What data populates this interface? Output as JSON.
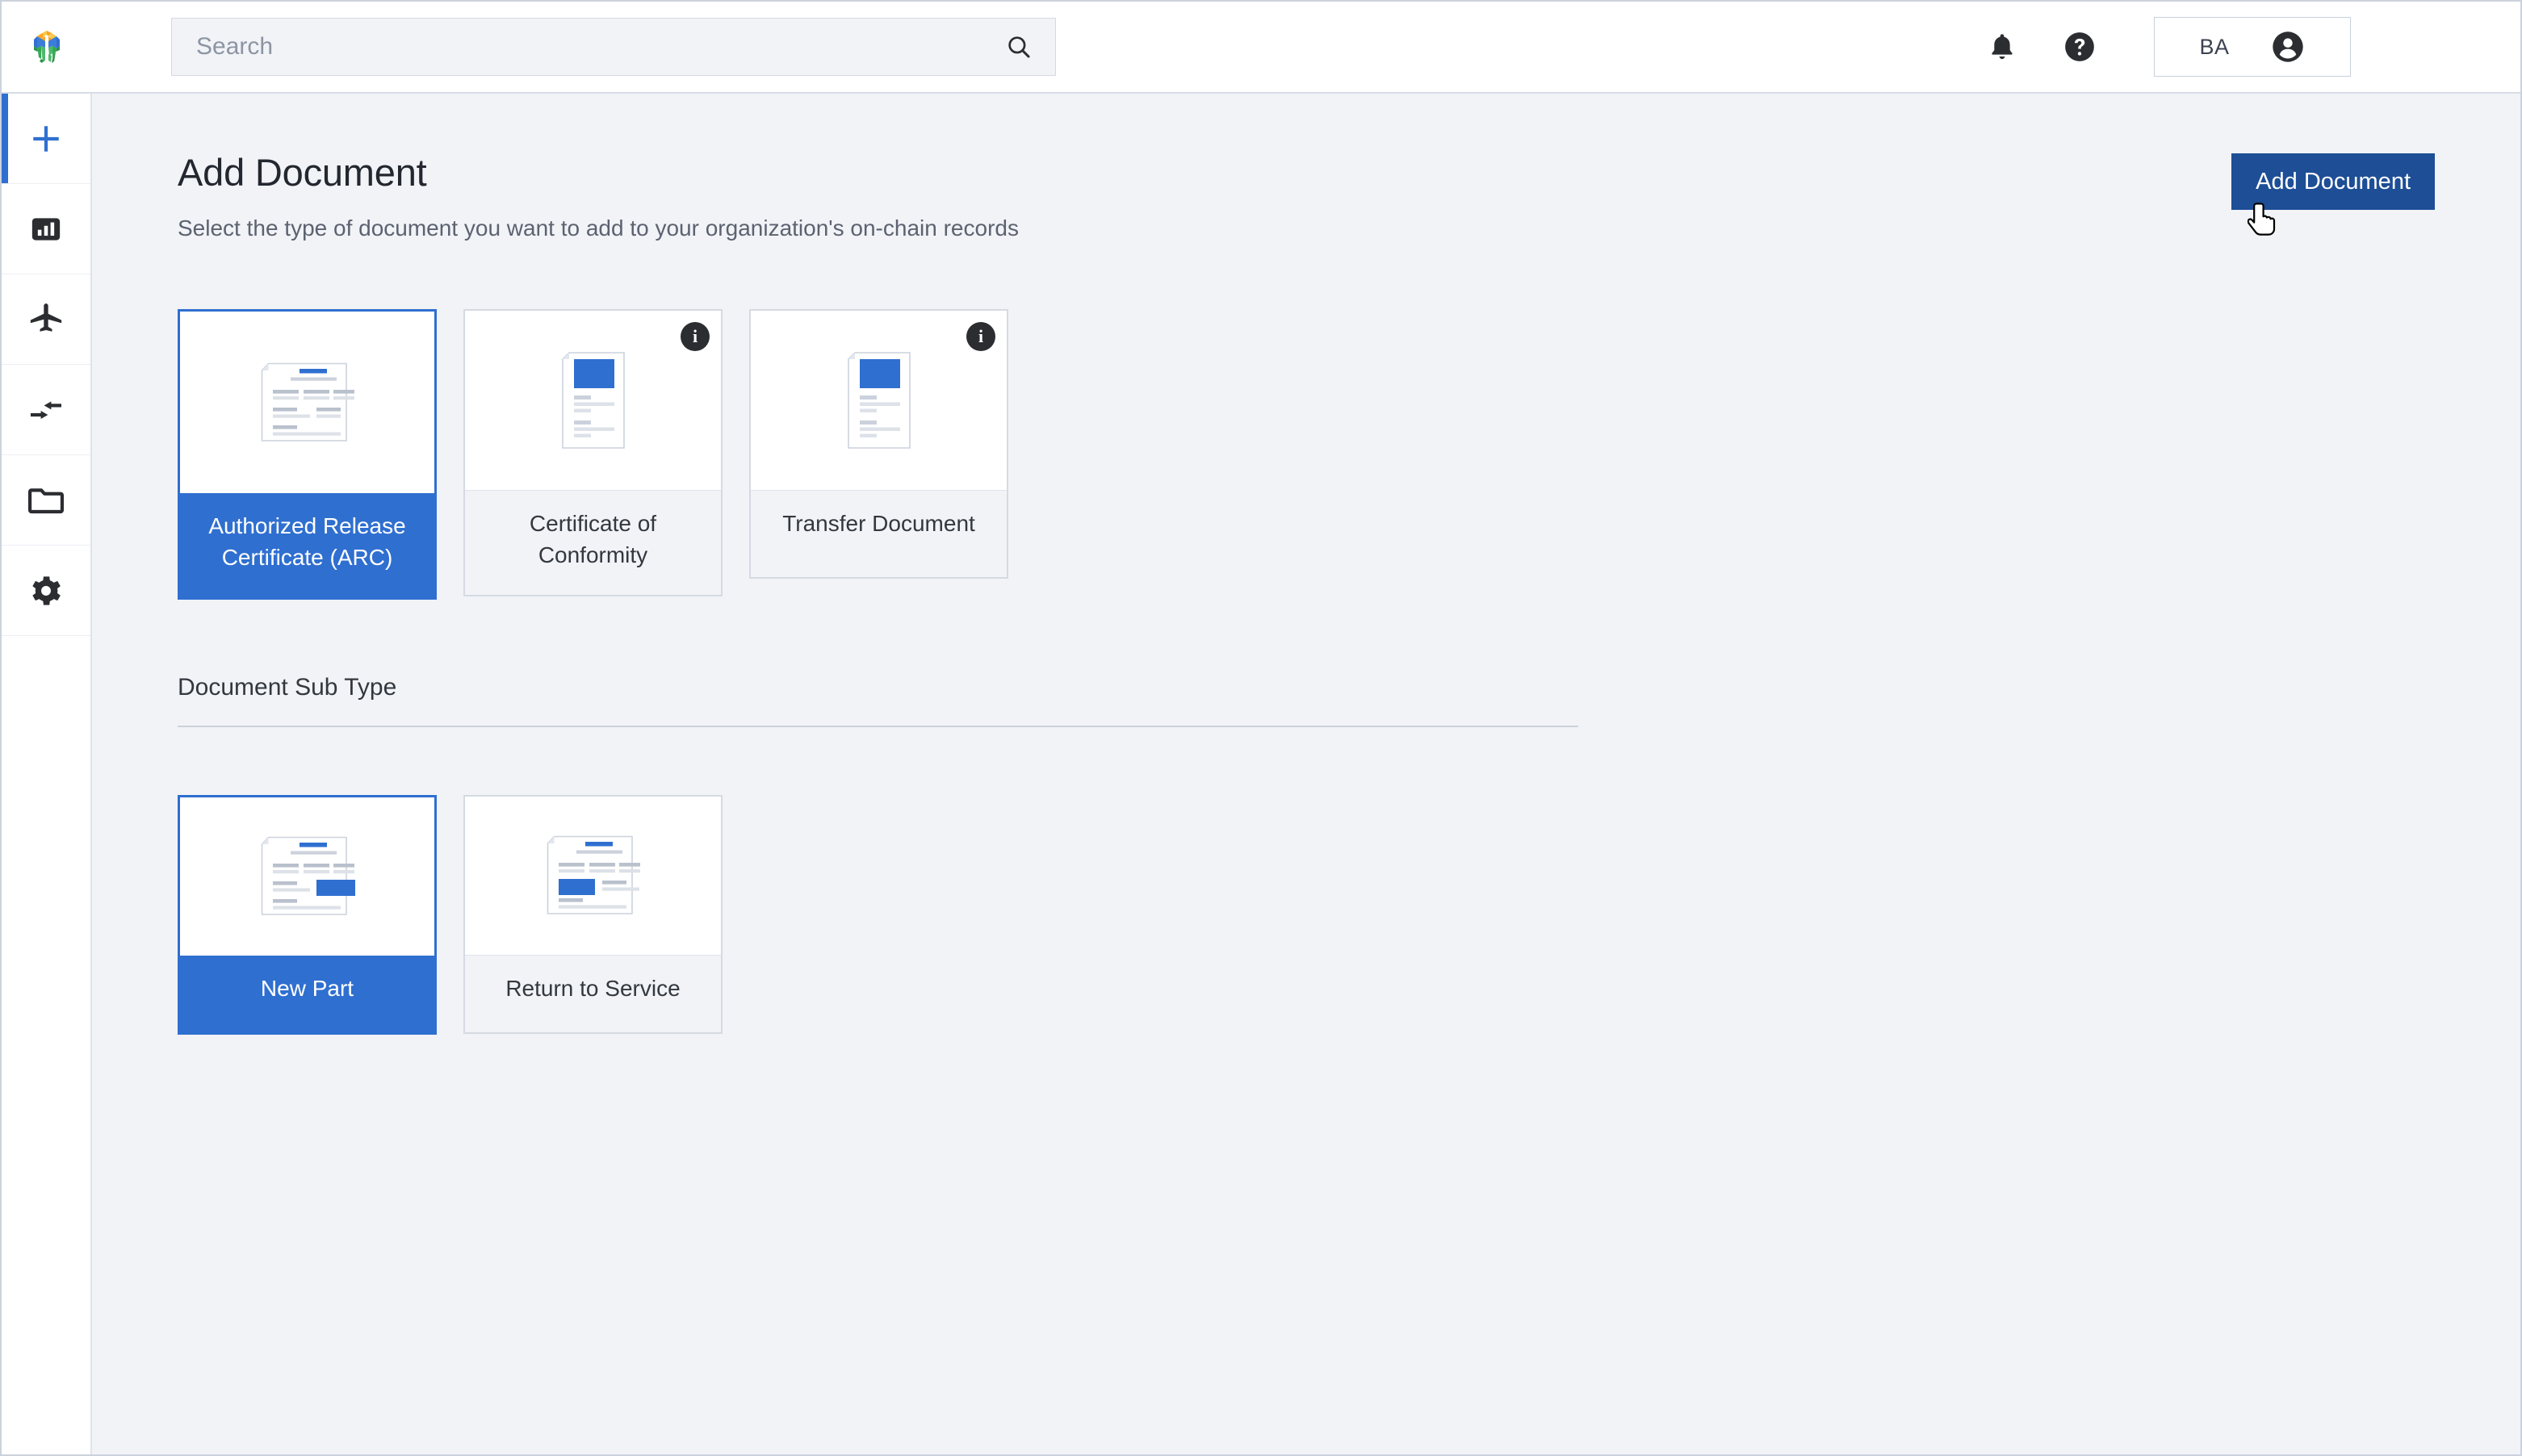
{
  "topbar": {
    "logo_name": "brand-hexagon-logo",
    "search": {
      "placeholder": "Search",
      "value": "",
      "icon": "search-icon"
    },
    "notifications_icon": "bell-icon",
    "help_icon": "help-circle-icon",
    "account": {
      "initials": "BA",
      "avatar_icon": "account-circle-icon"
    }
  },
  "sidebar": {
    "items": [
      {
        "icon": "plus-icon",
        "name": "add",
        "active": true
      },
      {
        "icon": "bar-chart-icon",
        "name": "dashboard",
        "active": false
      },
      {
        "icon": "airplane-icon",
        "name": "aircraft",
        "active": false
      },
      {
        "icon": "transfer-arrows-icon",
        "name": "transfers",
        "active": false
      },
      {
        "icon": "folder-icon",
        "name": "documents",
        "active": false
      },
      {
        "icon": "gear-icon",
        "name": "settings",
        "active": false
      }
    ]
  },
  "main": {
    "title": "Add Document",
    "subtitle": "Select the type of document you want to add to your organization's on-chain records",
    "add_button_label": "Add Document",
    "document_types": [
      {
        "label": "Authorized Release Certificate (ARC)",
        "selected": true,
        "has_info_badge": false,
        "icon": "document-landscape-icon"
      },
      {
        "label": "Certificate of Conformity",
        "selected": false,
        "has_info_badge": true,
        "icon": "document-portrait-icon"
      },
      {
        "label": "Transfer Document",
        "selected": false,
        "has_info_badge": true,
        "icon": "document-portrait-icon"
      }
    ],
    "subtype_section_title": "Document Sub Type",
    "document_subtypes": [
      {
        "label": "New Part",
        "selected": true,
        "has_info_badge": false,
        "icon": "document-landscape-right-block-icon"
      },
      {
        "label": "Return to Service",
        "selected": false,
        "has_info_badge": false,
        "icon": "document-landscape-left-block-icon"
      }
    ],
    "info_badge_glyph": "i"
  },
  "colors": {
    "accent_blue": "#2f6fd0",
    "button_blue": "#1d4e96",
    "page_bg": "#f1f3f7",
    "text_dark": "#23272f",
    "badge_dark": "#2b2d31"
  }
}
